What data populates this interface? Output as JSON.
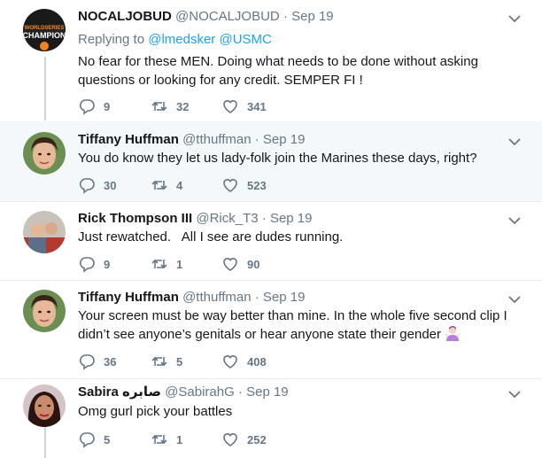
{
  "tweets": [
    {
      "name": "NOCALJOBUD",
      "handle": "@NOCALJOBUD",
      "date": "Sep 19",
      "reply_prefix": "Replying to",
      "reply_to_1": "@lmedsker",
      "reply_to_2": "@USMC",
      "avatar_text_1": "WORLDSERIES",
      "avatar_text_2": "CHAMPION",
      "text": "No fear for these MEN. Doing what needs to be done without asking questions or looking for any credit. SEMPER FI !",
      "replies": "9",
      "retweets": "32",
      "likes": "341"
    },
    {
      "name": "Tiffany Huffman",
      "handle": "@tthuffman",
      "date": "Sep 19",
      "text": "You do know they let us lady-folk join the Marines these days, right?",
      "replies": "30",
      "retweets": "4",
      "likes": "523"
    },
    {
      "name": "Rick Thompson III",
      "handle": "@Rick_T3",
      "date": "Sep 19",
      "text": "Just rewatched.   All I see are dudes running.",
      "replies": "9",
      "retweets": "1",
      "likes": "90"
    },
    {
      "name": "Tiffany Huffman",
      "handle": "@tthuffman",
      "date": "Sep 19",
      "text": "Your screen must be way better than mine. In the whole five second clip I didn’t see anyone’s genitals or hear anyone state their gender",
      "replies": "36",
      "retweets": "5",
      "likes": "408"
    },
    {
      "name": "Sabira صابره",
      "handle": "@SabirahG",
      "date": "Sep 19",
      "text": "Omg gurl pick your battles",
      "replies": "5",
      "retweets": "1",
      "likes": "252"
    }
  ],
  "separator": "·",
  "colors": {
    "accent": "#1da1f2",
    "muted": "#657786",
    "highlight_bg": "#f5f8fa"
  }
}
